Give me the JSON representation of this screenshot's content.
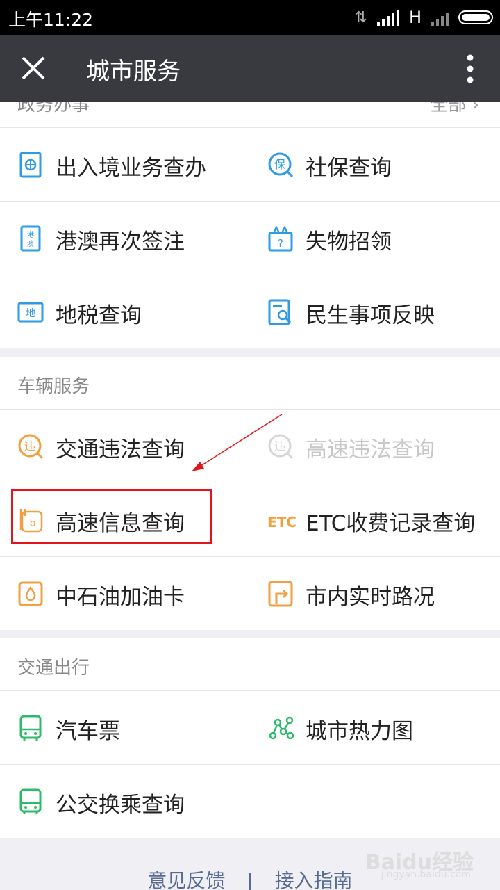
{
  "status_bar": {
    "time": "上午11:22",
    "network": "H"
  },
  "title_bar": {
    "title": "城市服务"
  },
  "sections": {
    "gov": {
      "header": "政务办事",
      "more": "全部",
      "rows": [
        [
          {
            "label": "出入境业务查办",
            "icon": "passport-globe-icon"
          },
          {
            "label": "社保查询",
            "icon": "social-security-bao-icon"
          }
        ],
        [
          {
            "label": "港澳再次签注",
            "icon": "hk-macau-pass-icon"
          },
          {
            "label": "失物招领",
            "icon": "lost-found-box-icon"
          }
        ],
        [
          {
            "label": "地税查询",
            "icon": "local-tax-di-icon"
          },
          {
            "label": "民生事项反映",
            "icon": "document-search-icon"
          }
        ]
      ]
    },
    "vehicle": {
      "header": "车辆服务",
      "rows": [
        [
          {
            "label": "交通违法查询",
            "icon": "traffic-violation-wei-icon"
          },
          {
            "label": "高速违法查询",
            "icon": "highway-violation-wei-icon"
          }
        ],
        [
          {
            "label": "高速信息查询",
            "icon": "highway-info-icon"
          },
          {
            "label": "ETC收费记录查询",
            "icon": "etc-icon",
            "icon_text": "ETC"
          }
        ],
        [
          {
            "label": "中石油加油卡",
            "icon": "fuel-card-drop-icon"
          },
          {
            "label": "市内实时路况",
            "icon": "road-condition-icon"
          }
        ]
      ]
    },
    "transit": {
      "header": "交通出行",
      "rows": [
        [
          {
            "label": "汽车票",
            "icon": "bus-ticket-icon"
          },
          {
            "label": "城市热力图",
            "icon": "heatmap-nodes-icon"
          }
        ],
        [
          {
            "label": "公交换乘查询",
            "icon": "bus-transfer-icon"
          }
        ]
      ]
    }
  },
  "footer": {
    "feedback": "意见反馈",
    "separator": "|",
    "guide": "接入指南"
  },
  "watermark": {
    "brand": "Baidu经验",
    "url": "jingyan.baidu.com"
  },
  "colors": {
    "gov_icon": "#2e9be6",
    "vehicle_icon": "#f0a040",
    "transit_icon": "#2dbb6a",
    "highlight": "#e4141b",
    "title_bar": "#393a3f",
    "link": "#576b95"
  }
}
